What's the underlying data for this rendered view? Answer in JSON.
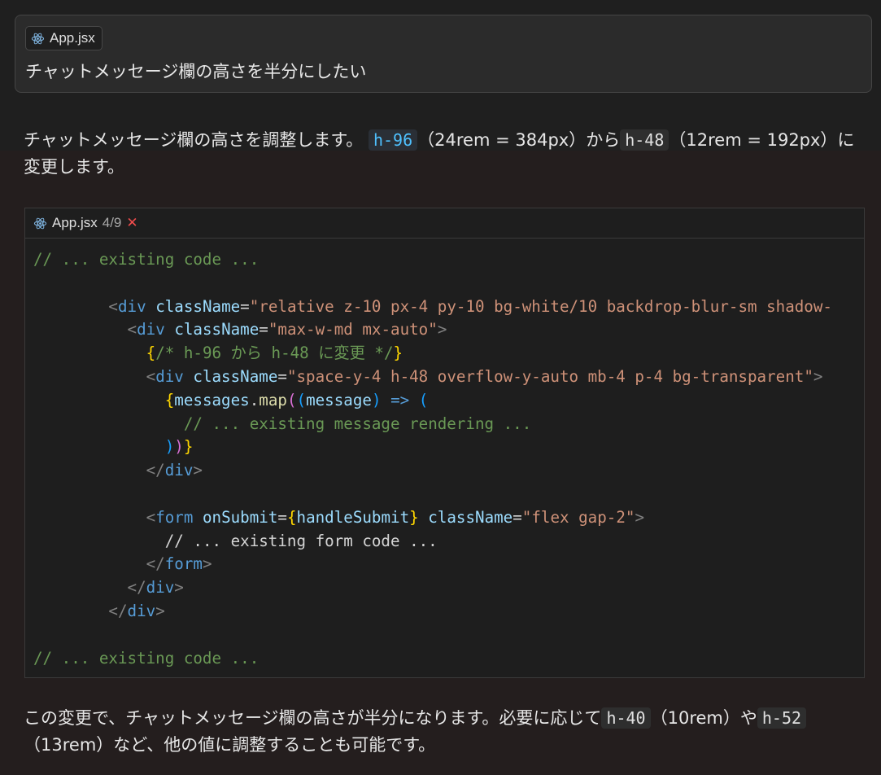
{
  "user_card": {
    "file_chip": "App.jsx",
    "message": "チャットメッセージ欄の高さを半分にしたい"
  },
  "response": {
    "p1": {
      "t1": "チャットメッセージ欄の高さを調整します。",
      "code1": "h-96",
      "t2": "（24rem = 384px）から",
      "code2": "h-48",
      "t3": "（12rem = 192px）に変更します。"
    },
    "p2": {
      "t1": "この変更で、チャットメッセージ欄の高さが半分になります。必要に応じて",
      "code1": "h-40",
      "t2": "（10rem）や",
      "code2": "h-52",
      "t3": "（13rem）など、他の値に調整することも可能です。"
    }
  },
  "code_block": {
    "filename": "App.jsx",
    "count": "4/9",
    "close": "✕",
    "lines": {
      "l1": "// ... existing code ...",
      "l3_cls": "relative z-10 px-4 py-10 bg-white/10 backdrop-blur-sm shadow-",
      "l4_cls": "max-w-md mx-auto",
      "l5_comment": "/* h-96 から h-48 に変更 */",
      "l6_cls": "space-y-4 h-48 overflow-y-auto mb-4 p-4 bg-transparent",
      "l7_obj": "messages",
      "l7_fn": "map",
      "l7_param": "message",
      "l8": "// ... existing message rendering ...",
      "l11_handler": "handleSubmit",
      "l11_cls": "flex gap-2",
      "l12": "// ... existing form code ...",
      "l18": "// ... existing code ..."
    }
  },
  "colors": {
    "accent_blue": "#4fc1ff",
    "close_red": "#f14c4c",
    "react_icon": "#7fb4e0"
  },
  "icons": {
    "file_icon": "react-icon"
  }
}
